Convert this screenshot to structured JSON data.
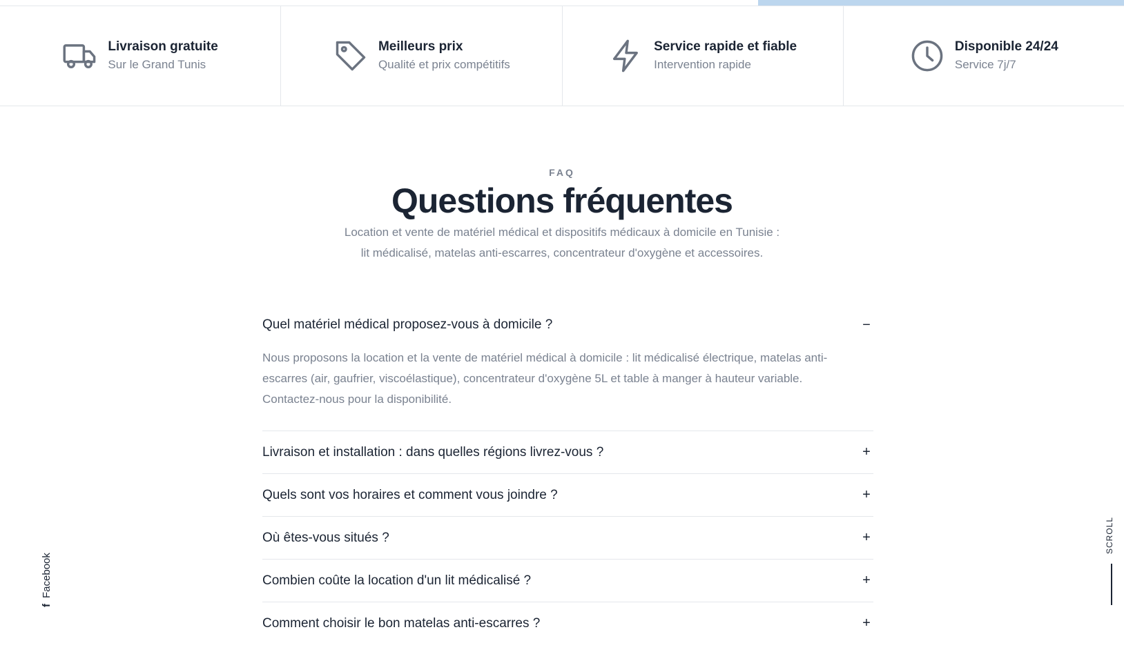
{
  "colors": {
    "accent_bar": "#bcd6ee",
    "text_dark": "#1b2433",
    "text_muted": "#7a8290",
    "divider": "#e4e7eb"
  },
  "features": [
    {
      "icon": "truck-icon",
      "title": "Livraison gratuite",
      "subtitle": "Sur le Grand Tunis"
    },
    {
      "icon": "price-tag-icon",
      "title": "Meilleurs prix",
      "subtitle": "Qualité et prix compétitifs"
    },
    {
      "icon": "lightning-icon",
      "title": "Service rapide et fiable",
      "subtitle": "Intervention rapide"
    },
    {
      "icon": "clock-icon",
      "title": "Disponible 24/24",
      "subtitle": "Service 7j/7"
    }
  ],
  "faq": {
    "eyebrow": "FAQ",
    "title": "Questions fréquentes",
    "lead_line1": "Location et vente de matériel médical et dispositifs médicaux à domicile en Tunisie :",
    "lead_line2": "lit médicalisé, matelas anti-escarres, concentrateur d'oxygène et accessoires.",
    "items": [
      {
        "question": "Quel matériel médical proposez-vous à domicile ?",
        "answer": "Nous proposons la location et la vente de matériel médical à domicile : lit médicalisé électrique, matelas anti-escarres (air, gaufrier, viscoélastique), concentrateur d'oxygène 5L et table à manger à hauteur variable. Contactez-nous pour la disponibilité.",
        "toggle": "−",
        "open": true
      },
      {
        "question": "Livraison et installation : dans quelles régions livrez-vous ?",
        "toggle": "+"
      },
      {
        "question": "Quels sont vos horaires et comment vous joindre ?",
        "toggle": "+"
      },
      {
        "question": "Où êtes-vous situés ?",
        "toggle": "+"
      },
      {
        "question": "Combien coûte la location d'un lit médicalisé ?",
        "toggle": "+"
      },
      {
        "question": "Comment choisir le bon matelas anti-escarres ?",
        "toggle": "+"
      }
    ]
  },
  "social": {
    "icon": "facebook-icon",
    "glyph": "f",
    "label": "Facebook"
  },
  "scroll_indicator": {
    "label": "SCROLL"
  }
}
